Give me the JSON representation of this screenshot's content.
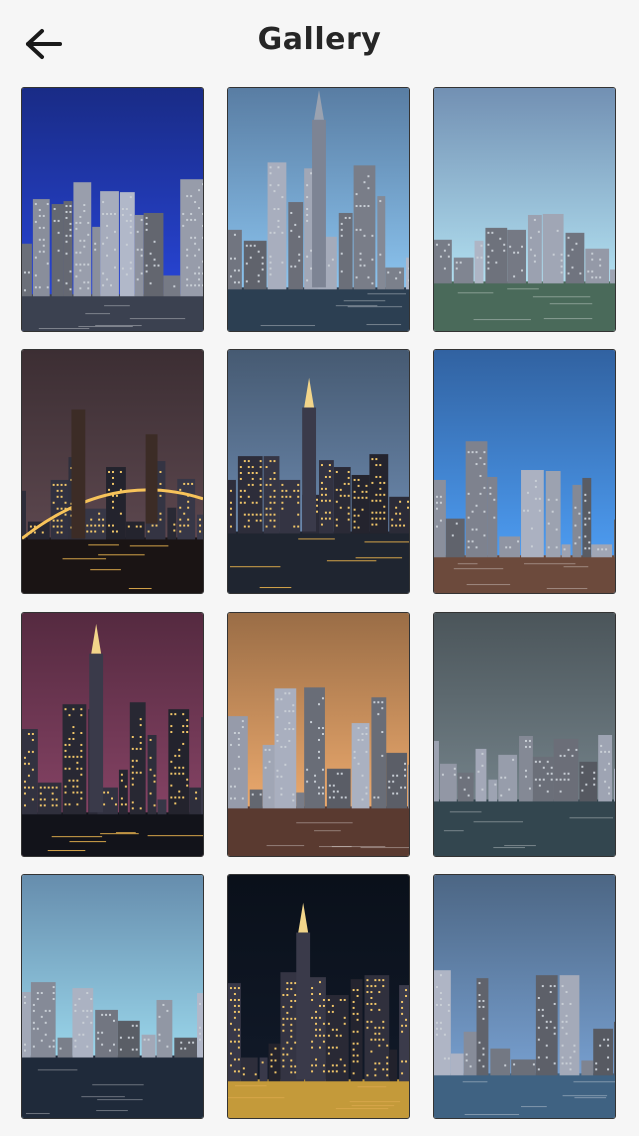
{
  "header": {
    "title": "Gallery"
  },
  "gallery": {
    "items": [
      {
        "scene": "twin-towers-skyline-day",
        "sky": "#1f36a8",
        "water": "#3b4150"
      },
      {
        "scene": "empire-state-aerial-day",
        "sky": "#6f9ccc",
        "water": "#2c3f52"
      },
      {
        "scene": "lower-manhattan-aerial-day",
        "sky": "#8fb4e0",
        "water": "#4a6a5a"
      },
      {
        "scene": "bridge-at-night",
        "sky": "#4b3a40",
        "water": "#1a1414"
      },
      {
        "scene": "empire-state-dusk",
        "sky": "#58708e",
        "water": "#1f2530"
      },
      {
        "scene": "midtown-aerial-day",
        "sky": "#3d7bc9",
        "water": "#6c4a3c"
      },
      {
        "scene": "empire-state-night-purple",
        "sky": "#6a3550",
        "water": "#12131a"
      },
      {
        "scene": "midtown-sunset-buildings",
        "sky": "#c08858",
        "water": "#5a3a30"
      },
      {
        "scene": "lower-manhattan-aerial-sunset",
        "sky": "#5e6a70",
        "water": "#33464f"
      },
      {
        "scene": "skyline-blue-day",
        "sky": "#7fb0d8",
        "water": "#1f2a3a"
      },
      {
        "scene": "chrysler-night",
        "sky": "#0d1420",
        "water": "#c49a3a"
      },
      {
        "scene": "manhattan-island-aerial",
        "sky": "#5f7fa5",
        "water": "#3f6282"
      }
    ]
  }
}
